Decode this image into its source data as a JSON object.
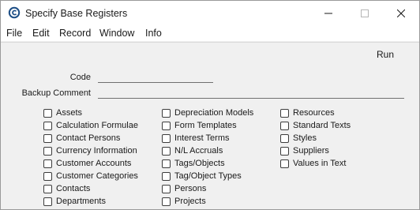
{
  "window": {
    "title": "Specify Base Registers"
  },
  "menu": [
    "File",
    "Edit",
    "Record",
    "Window",
    "Info"
  ],
  "toolbar": {
    "run_label": "Run"
  },
  "fields": {
    "code_label": "Code",
    "code_value": "",
    "backup_comment_label": "Backup Comment",
    "backup_comment_value": ""
  },
  "checkbox_columns": [
    [
      "Assets",
      "Calculation Formulae",
      "Contact Persons",
      "Currency Information",
      "Customer Accounts",
      "Customer Categories",
      "Contacts",
      "Departments"
    ],
    [
      "Depreciation Models",
      "Form Templates",
      "Interest Terms",
      "N/L Accruals",
      "Tags/Objects",
      "Tag/Object Types",
      "Persons",
      "Projects"
    ],
    [
      "Resources",
      "Standard Texts",
      "Styles",
      "Suppliers",
      "Values in Text"
    ]
  ],
  "colors": {
    "titlebar_bg": "#ffffff",
    "window_bg": "#f0f0f0",
    "checkbox_border": "#3c3c3c"
  }
}
